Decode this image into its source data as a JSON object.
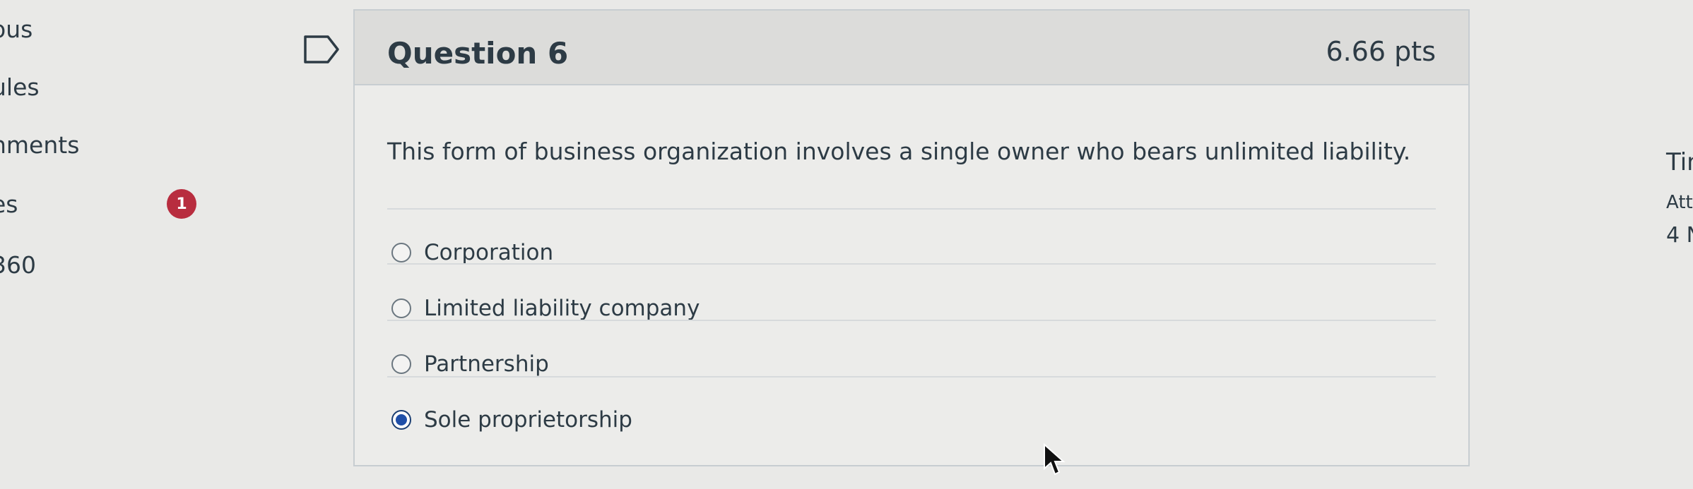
{
  "nav": {
    "items": [
      "ous",
      "ules",
      "nments",
      "es",
      "360"
    ],
    "badge_count": "1"
  },
  "question": {
    "title": "Question 6",
    "points": "6.66 pts",
    "text": "This form of business organization involves a single owner who bears unlimited liability.",
    "answers": [
      {
        "label": "Corporation",
        "selected": false
      },
      {
        "label": "Limited liability company",
        "selected": false
      },
      {
        "label": "Partnership",
        "selected": false
      },
      {
        "label": "Sole proprietorship",
        "selected": true
      }
    ]
  },
  "right_panel": {
    "line1": "Tin",
    "line2": "Att",
    "line3": "4 N"
  },
  "colors": {
    "background": "#e9e9e7",
    "header_bg": "#dcdcda",
    "badge": "#b82d3f",
    "radio_selected": "#1f4fa8",
    "text": "#2d3b45"
  },
  "icons": [
    "bookmark-icon",
    "notification-badge",
    "mouse-cursor-icon"
  ]
}
